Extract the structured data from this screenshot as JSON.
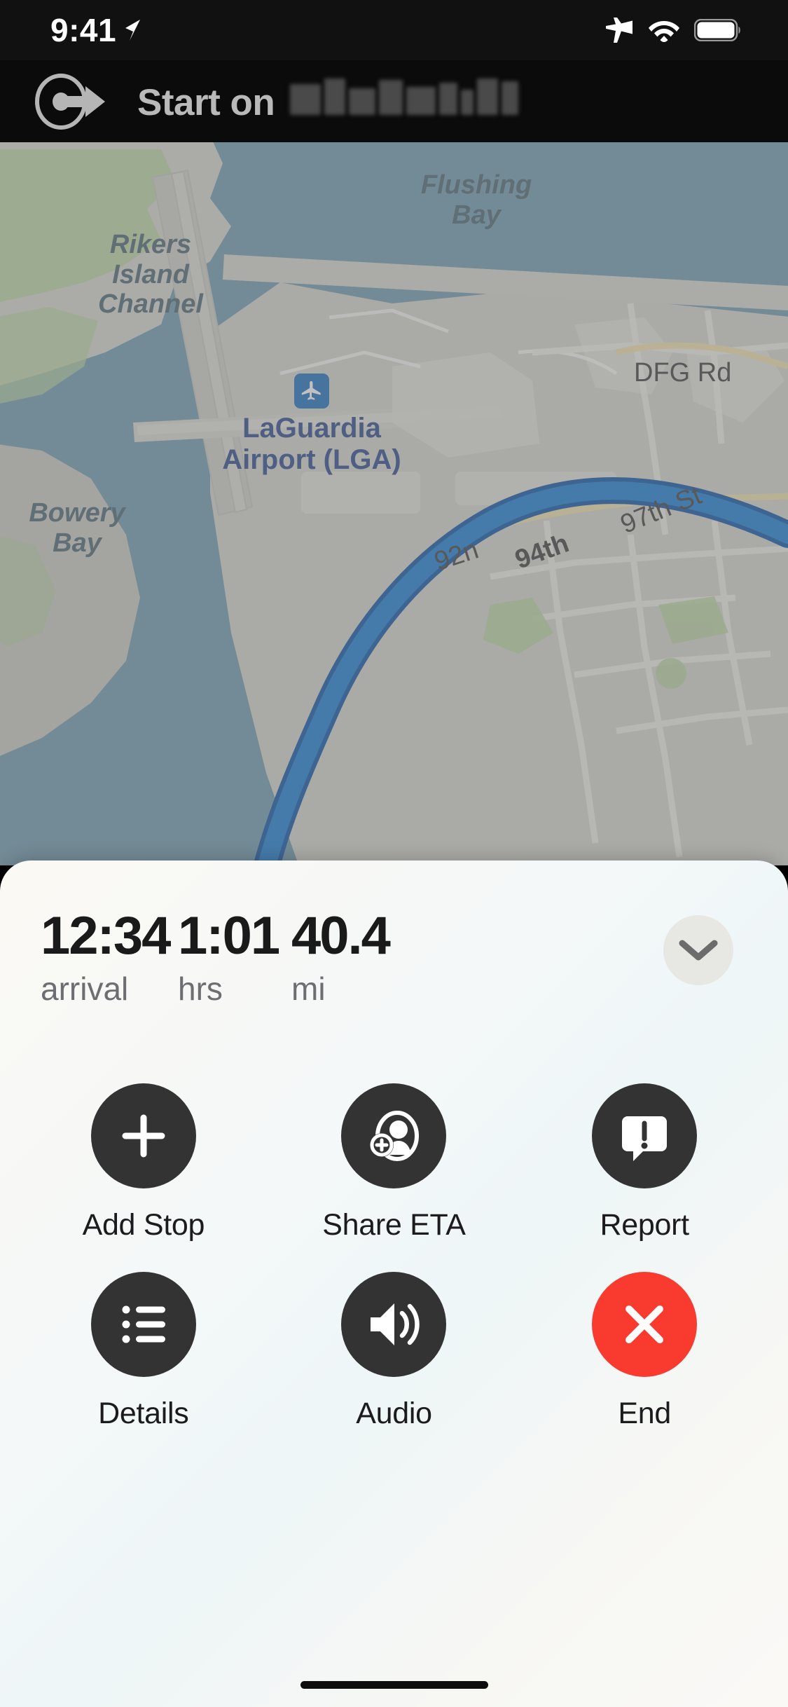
{
  "status_bar": {
    "time": "9:41",
    "icons": [
      "location-arrow-icon",
      "airplane-mode-icon",
      "wifi-icon",
      "battery-icon"
    ]
  },
  "nav_banner": {
    "instruction": "Start on",
    "street_name_redacted": true,
    "turn_icon": "depart-start-arrow-icon",
    "background_color": "#0b0b0b",
    "text_color": "#b9b9b9"
  },
  "map": {
    "water_color": "#6f9bb0",
    "land_color": "#d9d9d3",
    "park_color": "#b9d6a0",
    "route_color": "#1a7fd4",
    "route_casing_color": "#0d55a8",
    "labels": [
      {
        "text": "Flushing\nBay",
        "type": "water"
      },
      {
        "text": "Rikers\nIsland\nChannel",
        "type": "water"
      },
      {
        "text": "Bowery\nBay",
        "type": "water"
      },
      {
        "text": "DFG Rd",
        "type": "road"
      },
      {
        "text": "97th St",
        "type": "road"
      },
      {
        "text": "94th",
        "type": "road"
      },
      {
        "text": "92n",
        "type": "road"
      }
    ],
    "poi": {
      "name": "LaGuardia\nAirport (LGA)",
      "name_line1": "LaGuardia",
      "name_line2": "Airport (LGA)",
      "badge_icon": "airplane-icon",
      "badge_color": "#1f6fc0",
      "label_color": "#2b4a8c"
    }
  },
  "sheet": {
    "eta": {
      "arrival": {
        "value": "12:34",
        "label": "arrival"
      },
      "duration": {
        "value": "1:01",
        "label": "hrs"
      },
      "distance": {
        "value": "40.4",
        "label": "mi"
      }
    },
    "collapse_icon": "chevron-down-icon",
    "actions": [
      {
        "label": "Add Stop",
        "icon": "plus-icon",
        "style": "dark"
      },
      {
        "label": "Share ETA",
        "icon": "person-add-icon",
        "style": "dark"
      },
      {
        "label": "Report",
        "icon": "report-bubble-icon",
        "style": "dark"
      },
      {
        "label": "Details",
        "icon": "list-icon",
        "style": "dark"
      },
      {
        "label": "Audio",
        "icon": "speaker-wave-icon",
        "style": "dark"
      },
      {
        "label": "End",
        "icon": "close-x-icon",
        "style": "danger"
      }
    ],
    "colors": {
      "dark": "#333333",
      "danger": "#f93a2f",
      "label": "#1c1c1e"
    }
  }
}
